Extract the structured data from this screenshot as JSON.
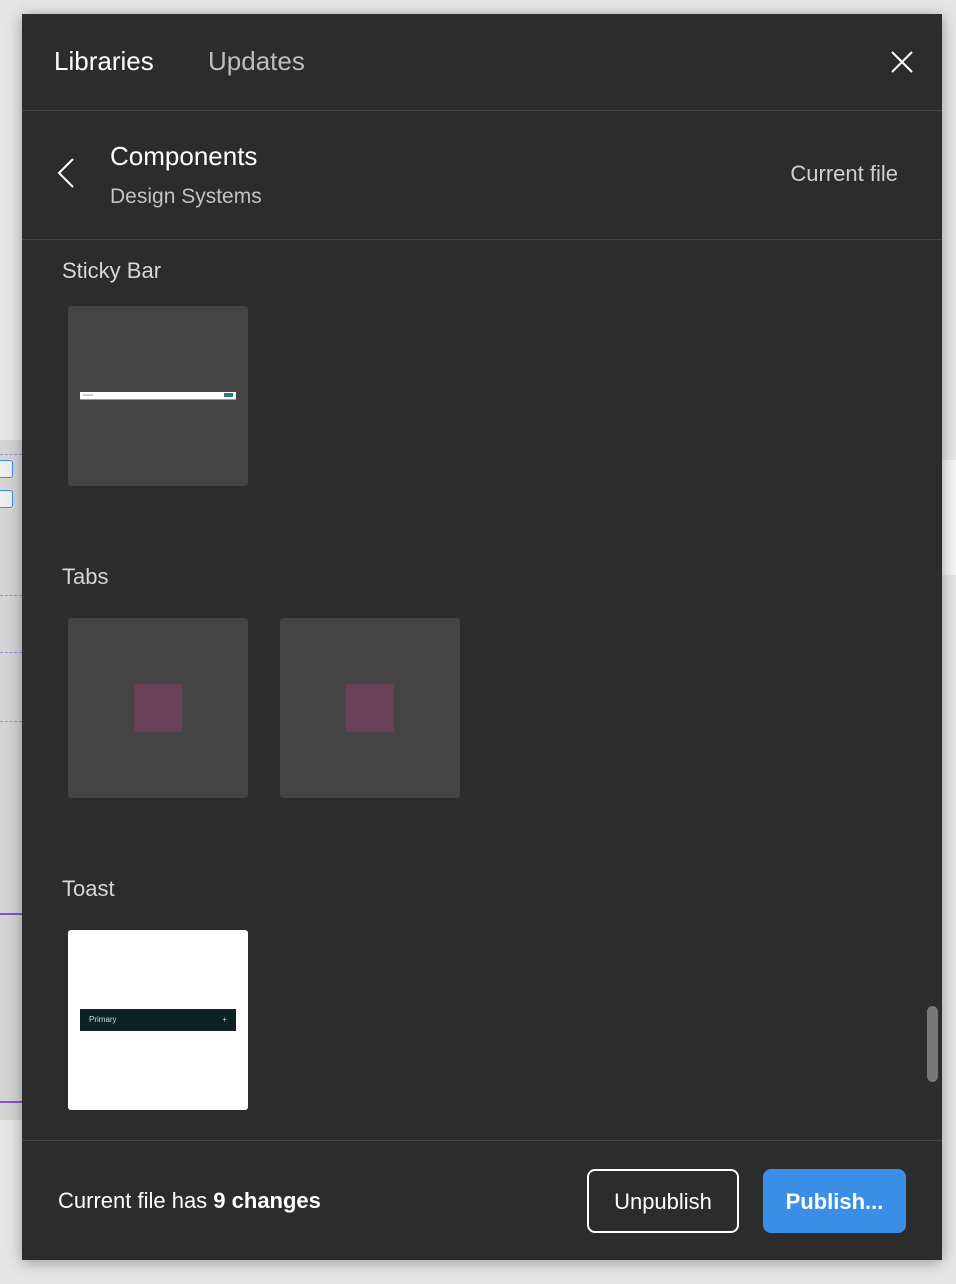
{
  "tabs": [
    {
      "label": "Libraries",
      "active": true
    },
    {
      "label": "Updates",
      "active": false
    }
  ],
  "header": {
    "title": "Components",
    "subtitle": "Design Systems",
    "current_file_label": "Current file"
  },
  "sections": [
    {
      "title": "Sticky Bar",
      "thumbnails": 1
    },
    {
      "title": "Tabs",
      "thumbnails": 2
    },
    {
      "title": "Toast",
      "thumbnails": 1,
      "toast_label": "Primary",
      "toast_icon": "+"
    }
  ],
  "footer": {
    "status_prefix": "Current file has ",
    "status_bold": "9 changes",
    "unpublish_label": "Unpublish",
    "publish_label": "Publish..."
  },
  "colors": {
    "panel": "#2c2c2c",
    "accent": "#3b8ee6",
    "tab_thumb_swatch": "#6a4157",
    "toast_bg": "#0c2224"
  }
}
